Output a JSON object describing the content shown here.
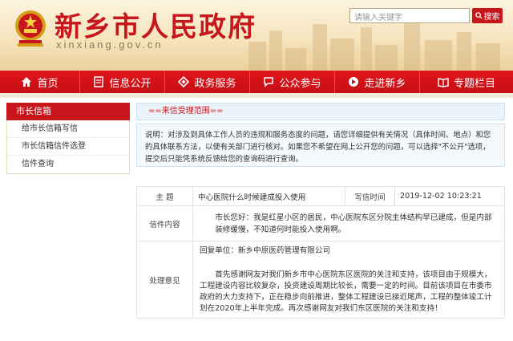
{
  "header": {
    "site_title": "新乡市人民政府",
    "site_domain": "xinxiang.gov.cn",
    "search_placeholder": "请输入关键字",
    "search_button": "搜索"
  },
  "nav": {
    "items": [
      {
        "label": "首页",
        "icon": "home-icon"
      },
      {
        "label": "信息公开",
        "icon": "document-icon"
      },
      {
        "label": "政务服务",
        "icon": "diamond-icon"
      },
      {
        "label": "公众参与",
        "icon": "chat-icon"
      },
      {
        "label": "走进新乡",
        "icon": "arrow-circle-icon"
      },
      {
        "label": "专题栏目",
        "icon": "book-icon"
      }
    ]
  },
  "sidebar": {
    "title": "市长信箱",
    "items": [
      {
        "label": "给市长信箱写信"
      },
      {
        "label": "市长信箱信件选登"
      },
      {
        "label": "信件查询"
      }
    ]
  },
  "main": {
    "scope_title": "==来信受理范围==",
    "notice": "说明：对涉及到具体工作人员的违规和服务态度的问题，请您详细提供有关情况（具体时间、地点）和您的具体联系方法，以便有关部门进行核对。如果您不希望在网上公开您的问题，可以选择\"不公开\"选项，提交后只能凭系统反馈给您的查询码进行查询。",
    "letter": {
      "subject_label": "主 题",
      "subject": "中心医院什么时候建成投入使用",
      "date_label": "写信时间",
      "date": "2019-12-02 10:23:21",
      "content_label": "信件内容",
      "content": "市长您好：我是红星小区的居民，中心医院东区分院主体结构早已建成，但是内部装修缓慢，不知道何时能投入使用啊。",
      "reply_label": "处理意见",
      "reply_unit": "回复单位：新乡中原医药管理有限公司",
      "reply_text": "首先感谢网友对我们新乡市中心医院东区医院的关注和支持，该项目由于规模大，工程建设内容比较复杂，投资建设周期比较长，需要一定的时间。目前该项目在市委市政府的大力支持下，正在稳步向前推进，整体工程建设已接近尾声，工程的整体竣工计划在2020年上半年完成。再次感谢网友对我们东区医院的关注和支持！"
    }
  }
}
